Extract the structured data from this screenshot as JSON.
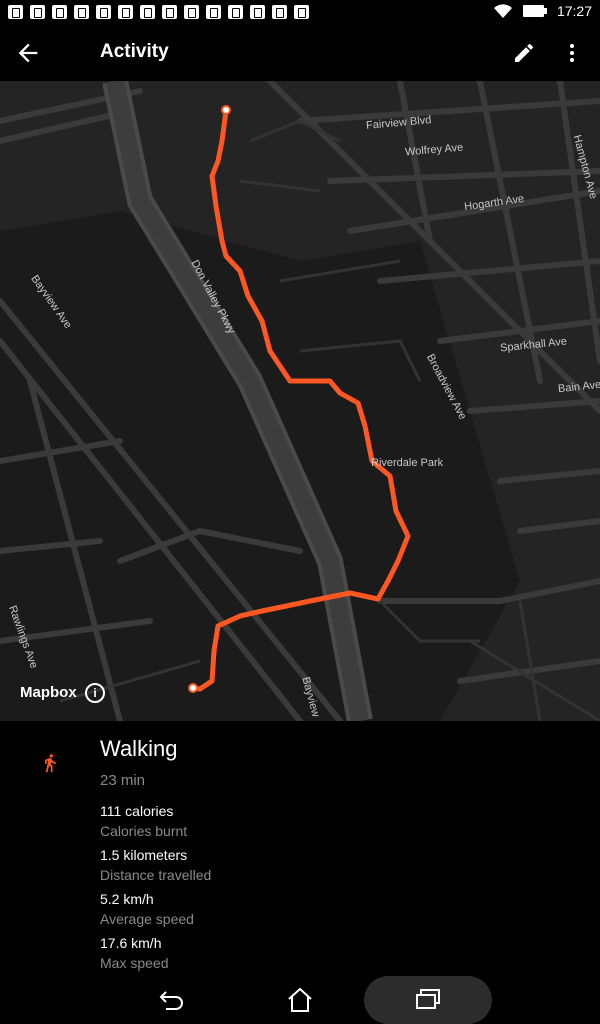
{
  "status_bar": {
    "time": "17:27",
    "battery_icon": "battery-icon",
    "wifi_icon": "wifi-icon"
  },
  "app_bar": {
    "title": "Activity",
    "back_icon": "arrow-back-icon",
    "edit_icon": "pencil-icon",
    "more_icon": "more-vert-icon"
  },
  "map": {
    "attribution": "Mapbox",
    "info_glyph": "i",
    "labels": [
      "Fairview Blvd",
      "Wolfrey Ave",
      "Hogarth Ave",
      "Hampton Ave",
      "Sparkhall Ave",
      "Bain Ave",
      "Broadview Ave",
      "Riverdale Park",
      "Don Valley Pkwy",
      "Bayview Ave",
      "Bayview",
      "Rawlings Ave"
    ],
    "route_color": "#ff5722"
  },
  "activity": {
    "type": "Walking",
    "duration": "23 min",
    "stats": [
      {
        "value": "111 calories",
        "label": "Calories burnt"
      },
      {
        "value": "1.5 kilometers",
        "label": "Distance travelled"
      },
      {
        "value": "5.2 km/h",
        "label": "Average speed"
      },
      {
        "value": "17.6 km/h",
        "label": "Max speed"
      }
    ]
  },
  "accent_color": "#ff5722"
}
